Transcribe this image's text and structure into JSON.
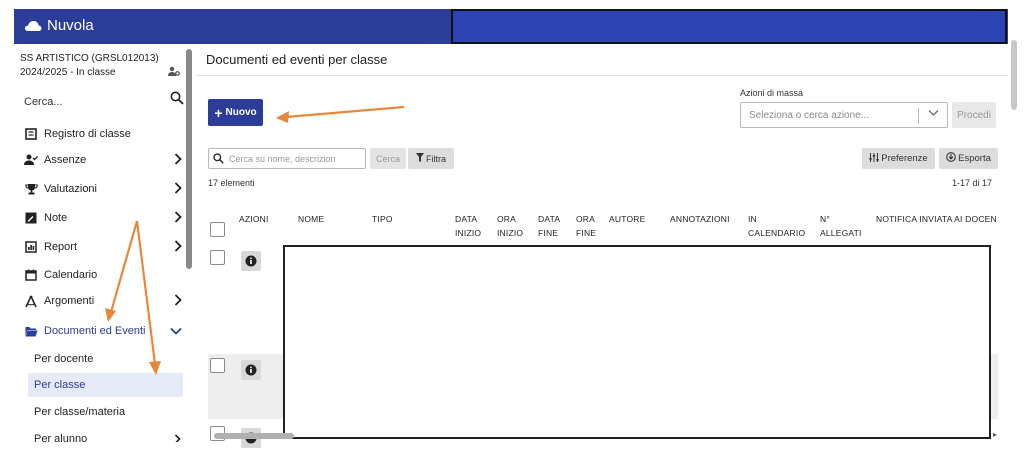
{
  "app": {
    "name": "Nuvola",
    "icon": "cloud-icon"
  },
  "sidebar": {
    "school_name": "SS ARTISTICO (GRSL012013)",
    "school_year": "2024/2025 - In classe",
    "search_label": "Cerca...",
    "items": [
      {
        "label": "Registro di classe",
        "icon": "book-icon"
      },
      {
        "label": "Assenze",
        "icon": "user-check-icon"
      },
      {
        "label": "Valutazioni",
        "icon": "trophy-icon"
      },
      {
        "label": "Note",
        "icon": "note-icon"
      },
      {
        "label": "Report",
        "icon": "report-icon"
      },
      {
        "label": "Calendario",
        "icon": "calendar-icon"
      },
      {
        "label": "Argomenti",
        "icon": "compass-icon"
      },
      {
        "label": "Documenti ed Eventi",
        "icon": "folder-open-icon"
      }
    ],
    "sub_items": [
      {
        "label": "Per docente"
      },
      {
        "label": "Per classe"
      },
      {
        "label": "Per classe/materia"
      },
      {
        "label": "Per alunno"
      }
    ]
  },
  "main": {
    "title": "Documenti ed eventi per classe",
    "new_button": "Nuovo",
    "mass_actions": {
      "label": "Azioni di massa",
      "placeholder": "Seleziona o cerca azione...",
      "proceed": "Procedi"
    },
    "filter": {
      "placeholder": "Cerca su nome, descrizion",
      "search_button": "Cerca",
      "filter_button": "Filtra"
    },
    "preferences_button": "Preferenze",
    "export_button": "Esporta",
    "count": "17 elementi",
    "range": "1-17 di 17",
    "columns": [
      [
        "",
        "AZIONI"
      ],
      [
        "",
        "NOME"
      ],
      [
        "",
        "TIPO"
      ],
      [
        "DATA",
        "INIZIO"
      ],
      [
        "ORA",
        "INIZIO"
      ],
      [
        "DATA",
        "FINE"
      ],
      [
        "ORA",
        "FINE"
      ],
      [
        "",
        "AUTORE"
      ],
      [
        "",
        "ANNOTAZIONI"
      ],
      [
        "IN",
        "CALENDARIO"
      ],
      [
        "N°",
        "ALLEGATI"
      ],
      [
        "",
        "NOTIFICA INVIATA AI DOCEN"
      ]
    ]
  },
  "colors": {
    "brand": "#2b3d98",
    "annotation_arrow": "#e8873a"
  }
}
